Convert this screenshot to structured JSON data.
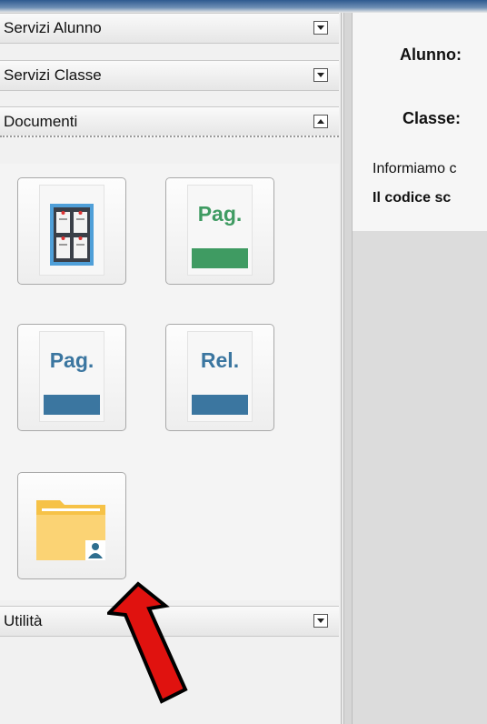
{
  "sidebar": {
    "sections": [
      {
        "label": "Servizi Alunno",
        "toggle": "expand"
      },
      {
        "label": "Servizi Classe",
        "toggle": "expand"
      },
      {
        "label": "Documenti",
        "toggle": "collapse"
      },
      {
        "label": "Utilità",
        "toggle": "expand"
      }
    ],
    "documents": [
      {
        "icon": "bulletin-board-icon"
      },
      {
        "icon": "report-card-icon",
        "code": "Pag.",
        "color": "#3f9b62"
      },
      {
        "icon": "report-card-icon",
        "code": "Pag.",
        "color": "#3b76a0"
      },
      {
        "icon": "report-icon",
        "code": "Rel.",
        "color": "#3b76a0"
      },
      {
        "icon": "student-folder-icon"
      }
    ]
  },
  "content": {
    "alunno_label": "Alunno:",
    "classe_label": "Classe:",
    "info_text": "Informiamo c",
    "code_text": "Il codice sc"
  },
  "annotation": {
    "icon": "red-arrow-icon",
    "color": "#e0120f"
  },
  "colors": {
    "accent": "#3b76a0",
    "green": "#3f9b62",
    "folder": "#f6c247"
  }
}
